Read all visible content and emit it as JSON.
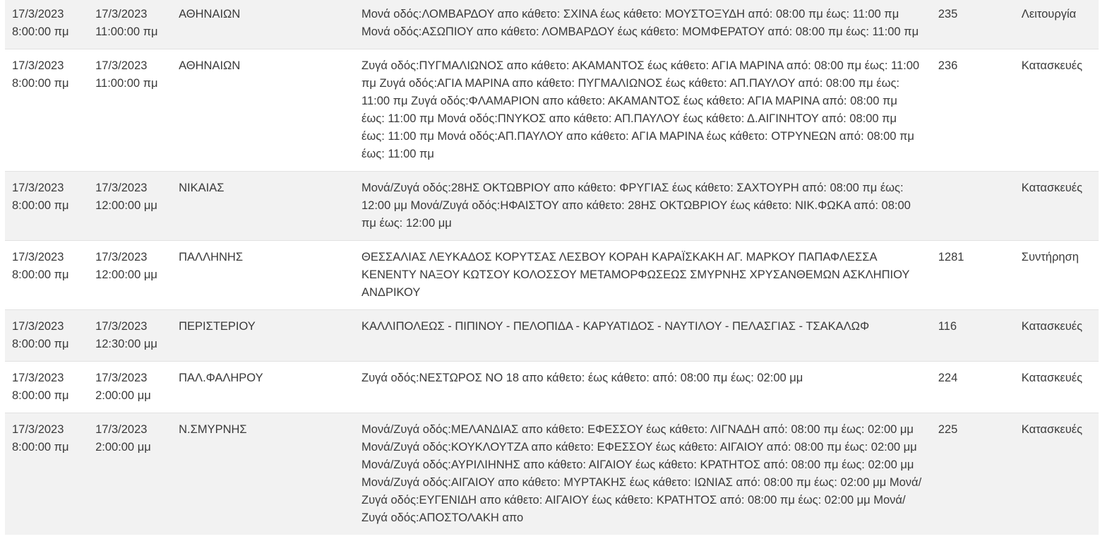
{
  "table": {
    "rows": [
      {
        "start_date": "17/3/2023",
        "start_time": "8:00:00 πμ",
        "end_date": "17/3/2023",
        "end_time": "11:00:00 πμ",
        "area": "ΑΘΗΝΑΙΩΝ",
        "description": "Μονά οδός:ΛΟΜΒΑΡΔΟΥ απο κάθετο: ΣΧΙΝΑ έως κάθετο: ΜΟΥΣΤΟΞΥΔΗ από: 08:00 πμ έως: 11:00 πμ Μονά οδός:ΑΣΩΠΙΟΥ απο κάθετο: ΛΟΜΒΑΡΔΟΥ έως κάθετο: ΜΟΜΦΕΡΑΤΟΥ από: 08:00 πμ έως: 11:00 πμ",
        "number": "235",
        "type": "Λειτουργία"
      },
      {
        "start_date": "17/3/2023",
        "start_time": "8:00:00 πμ",
        "end_date": "17/3/2023",
        "end_time": "11:00:00 πμ",
        "area": "ΑΘΗΝΑΙΩΝ",
        "description": "Ζυγά οδός:ΠΥΓΜΑΛΙΩΝΟΣ απο κάθετο: ΑΚΑΜΑΝΤΟΣ έως κάθετο: ΑΓΙΑ ΜΑΡΙΝΑ από: 08:00 πμ έως: 11:00 πμ Ζυγά οδός:ΑΓΙΑ ΜΑΡΙΝΑ απο κάθετο: ΠΥΓΜΑΛΙΩΝΟΣ έως κάθετο: ΑΠ.ΠΑΥΛΟΥ από: 08:00 πμ έως: 11:00 πμ Ζυγά οδός:ΦΛΑΜΑΡΙΟΝ απο κάθετο: ΑΚΑΜΑΝΤΟΣ έως κάθετο: ΑΓΙΑ ΜΑΡΙΝΑ από: 08:00 πμ έως: 11:00 πμ Μονά οδός:ΠΝΥΚΟΣ απο κάθετο: ΑΠ.ΠΑΥΛΟΥ έως κάθετο: Δ.ΑΙΓΙΝΗΤΟΥ από: 08:00 πμ έως: 11:00 πμ Μονά οδός:ΑΠ.ΠΑΥΛΟΥ απο κάθετο: ΑΓΙΑ ΜΑΡΙΝΑ έως κάθετο: ΟΤΡΥΝΕΩΝ από: 08:00 πμ έως: 11:00 πμ",
        "number": "236",
        "type": "Κατασκευές"
      },
      {
        "start_date": "17/3/2023",
        "start_time": "8:00:00 πμ",
        "end_date": "17/3/2023",
        "end_time": "12:00:00 μμ",
        "area": "ΝΙΚΑΙΑΣ",
        "description": "Μονά/Ζυγά οδός:28ΗΣ ΟΚΤΩΒΡΙΟΥ απο κάθετο: ΦΡΥΓΙΑΣ έως κάθετο: ΣΑΧΤΟΥΡΗ από: 08:00 πμ έως: 12:00 μμ Μονά/Ζυγά οδός:ΗΦΑΙΣΤΟΥ απο κάθετο: 28ΗΣ ΟΚΤΩΒΡΙΟΥ έως κάθετο: ΝΙΚ.ΦΩΚΑ από: 08:00 πμ έως: 12:00 μμ",
        "number": "",
        "type": "Κατασκευές"
      },
      {
        "start_date": "17/3/2023",
        "start_time": "8:00:00 πμ",
        "end_date": "17/3/2023",
        "end_time": "12:00:00 μμ",
        "area": "ΠΑΛΛΗΝΗΣ",
        "description": "ΘΕΣΣΑΛΙΑΣ ΛΕΥΚΑΔΟΣ ΚΟΡΥΤΣΑΣ ΛΕΣΒΟΥ ΚΟΡΑΗ ΚΑΡΑΪΣΚΑΚΗ ΑΓ. ΜΑΡΚΟΥ ΠΑΠΑΦΛΕΣΣΑ ΚΕΝΕΝΤΥ ΝΑΞΟΥ ΚΩΤΣΟΥ ΚΟΛΟΣΣΟΥ ΜΕΤΑΜΟΡΦΩΣΕΩΣ ΣΜΥΡΝΗΣ ΧΡΥΣΑΝΘΕΜΩΝ ΑΣΚΛΗΠΙΟΥ ΑΝΔΡΙΚΟΥ",
        "number": "1281",
        "type": "Συντήρηση"
      },
      {
        "start_date": "17/3/2023",
        "start_time": "8:00:00 πμ",
        "end_date": "17/3/2023",
        "end_time": "12:30:00 μμ",
        "area": "ΠΕΡΙΣΤΕΡΙΟΥ",
        "description": "ΚΑΛΛΙΠΟΛΕΩΣ - ΠΙΠΙΝΟΥ - ΠΕΛΟΠΙΔΑ - ΚΑΡΥΑΤΙΔΟΣ - ΝΑΥΤΙΛΟΥ - ΠΕΛΑΣΓΙΑΣ - ΤΣΑΚΑΛΩΦ",
        "number": "116",
        "type": "Κατασκευές"
      },
      {
        "start_date": "17/3/2023",
        "start_time": "8:00:00 πμ",
        "end_date": "17/3/2023",
        "end_time": "2:00:00 μμ",
        "area": "ΠΑΛ.ΦΑΛΗΡΟΥ",
        "description": "Ζυγά οδός:ΝΕΣΤΩΡΟΣ ΝΟ 18 απο κάθετο: έως κάθετο: από: 08:00 πμ έως: 02:00 μμ",
        "number": "224",
        "type": "Κατασκευές"
      },
      {
        "start_date": "17/3/2023",
        "start_time": "8:00:00 πμ",
        "end_date": "17/3/2023",
        "end_time": "2:00:00 μμ",
        "area": "Ν.ΣΜΥΡΝΗΣ",
        "description": "Μονά/Ζυγά οδός:ΜΕΛΑΝΔΙΑΣ απο κάθετο: ΕΦΕΣΣΟΥ έως κάθετο: ΛΙΓΝΑΔΗ από: 08:00 πμ έως: 02:00 μμ Μονά/Ζυγά οδός:ΚΟΥΚΛΟΥΤΖΑ απο κάθετο: ΕΦΕΣΣΟΥ έως κάθετο: ΑΙΓΑΙΟΥ από: 08:00 πμ έως: 02:00 μμ Μονά/Ζυγά οδός:ΑΥΡΙΛΙΗΝΗΣ απο κάθετο: ΑΙΓΑΙΟΥ έως κάθετο: ΚΡΑΤΗΤΟΣ από: 08:00 πμ έως: 02:00 μμ Μονά/Ζυγά οδός:ΑΙΓΑΙΟΥ απο κάθετο: ΜΥΡΤΑΚΗΣ έως κάθετο: ΙΩΝΙΑΣ από: 08:00 πμ έως: 02:00 μμ Μονά/Ζυγά οδός:ΕΥΓΕΝΙΔΗ απο κάθετο: ΑΙΓΑΙΟΥ έως κάθετο: ΚΡΑΤΗΤΟΣ από: 08:00 πμ έως: 02:00 μμ Μονά/Ζυγά οδός:ΑΠΟΣΤΟΛΑΚΗ απο",
        "number": "225",
        "type": "Κατασκευές"
      }
    ]
  }
}
